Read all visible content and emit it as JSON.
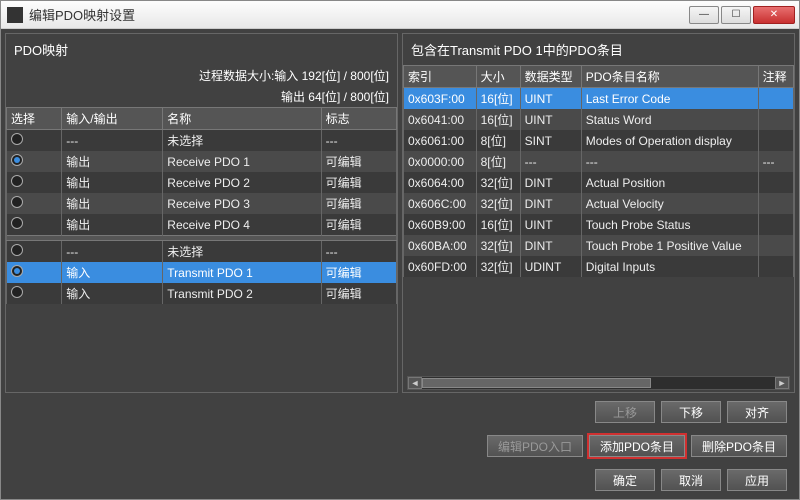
{
  "window": {
    "title": "编辑PDO映射设置"
  },
  "left": {
    "header": "PDO映射",
    "process1": "过程数据大小:输入  192[位]  /  800[位]",
    "process2": "输出   64[位]  /  800[位]",
    "columns": {
      "select": "选择",
      "io": "输入/输出",
      "name": "名称",
      "flag": "标志"
    },
    "groups": [
      {
        "rows": [
          {
            "sel": false,
            "io": "---",
            "name": "未选择",
            "flag": "---",
            "highlight": false
          },
          {
            "sel": true,
            "io": "输出",
            "name": "Receive PDO 1",
            "flag": "可编辑",
            "highlight": false
          },
          {
            "sel": false,
            "io": "输出",
            "name": "Receive PDO 2",
            "flag": "可编辑",
            "highlight": false
          },
          {
            "sel": false,
            "io": "输出",
            "name": "Receive PDO 3",
            "flag": "可编辑",
            "highlight": false
          },
          {
            "sel": false,
            "io": "输出",
            "name": "Receive PDO 4",
            "flag": "可编辑",
            "highlight": false
          }
        ]
      },
      {
        "rows": [
          {
            "sel": false,
            "io": "---",
            "name": "未选择",
            "flag": "---",
            "highlight": false
          },
          {
            "sel": true,
            "io": "输入",
            "name": "Transmit PDO 1",
            "flag": "可编辑",
            "highlight": true
          },
          {
            "sel": false,
            "io": "输入",
            "name": "Transmit PDO 2",
            "flag": "可编辑",
            "highlight": false
          }
        ]
      }
    ]
  },
  "right": {
    "header": "包含在Transmit PDO 1中的PDO条目",
    "columns": {
      "index": "索引",
      "size": "大小",
      "type": "数据类型",
      "name": "PDO条目名称",
      "note": "注释"
    },
    "rows": [
      {
        "index": "0x603F:00",
        "size": "16[位]",
        "type": "UINT",
        "name": "Last Error Code",
        "note": "",
        "sel": true
      },
      {
        "index": "0x6041:00",
        "size": "16[位]",
        "type": "UINT",
        "name": "Status Word",
        "note": "",
        "sel": false
      },
      {
        "index": "0x6061:00",
        "size": "8[位]",
        "type": "SINT",
        "name": "Modes of Operation display",
        "note": "",
        "sel": false
      },
      {
        "index": "0x0000:00",
        "size": "8[位]",
        "type": "---",
        "name": "---",
        "note": "---",
        "sel": false
      },
      {
        "index": "0x6064:00",
        "size": "32[位]",
        "type": "DINT",
        "name": "Actual Position",
        "note": "",
        "sel": false
      },
      {
        "index": "0x606C:00",
        "size": "32[位]",
        "type": "DINT",
        "name": "Actual Velocity",
        "note": "",
        "sel": false,
        "hl": true
      },
      {
        "index": "0x60B9:00",
        "size": "16[位]",
        "type": "UINT",
        "name": "Touch Probe Status",
        "note": "",
        "sel": false
      },
      {
        "index": "0x60BA:00",
        "size": "32[位]",
        "type": "DINT",
        "name": "Touch Probe 1 Positive Value",
        "note": "",
        "sel": false
      },
      {
        "index": "0x60FD:00",
        "size": "32[位]",
        "type": "UDINT",
        "name": "Digital Inputs",
        "note": "",
        "sel": false
      }
    ]
  },
  "buttons": {
    "up": "上移",
    "down": "下移",
    "align": "对齐",
    "editEntry": "编辑PDO入口",
    "addEntry": "添加PDO条目",
    "delEntry": "删除PDO条目",
    "ok": "确定",
    "cancel": "取消",
    "apply": "应用"
  }
}
